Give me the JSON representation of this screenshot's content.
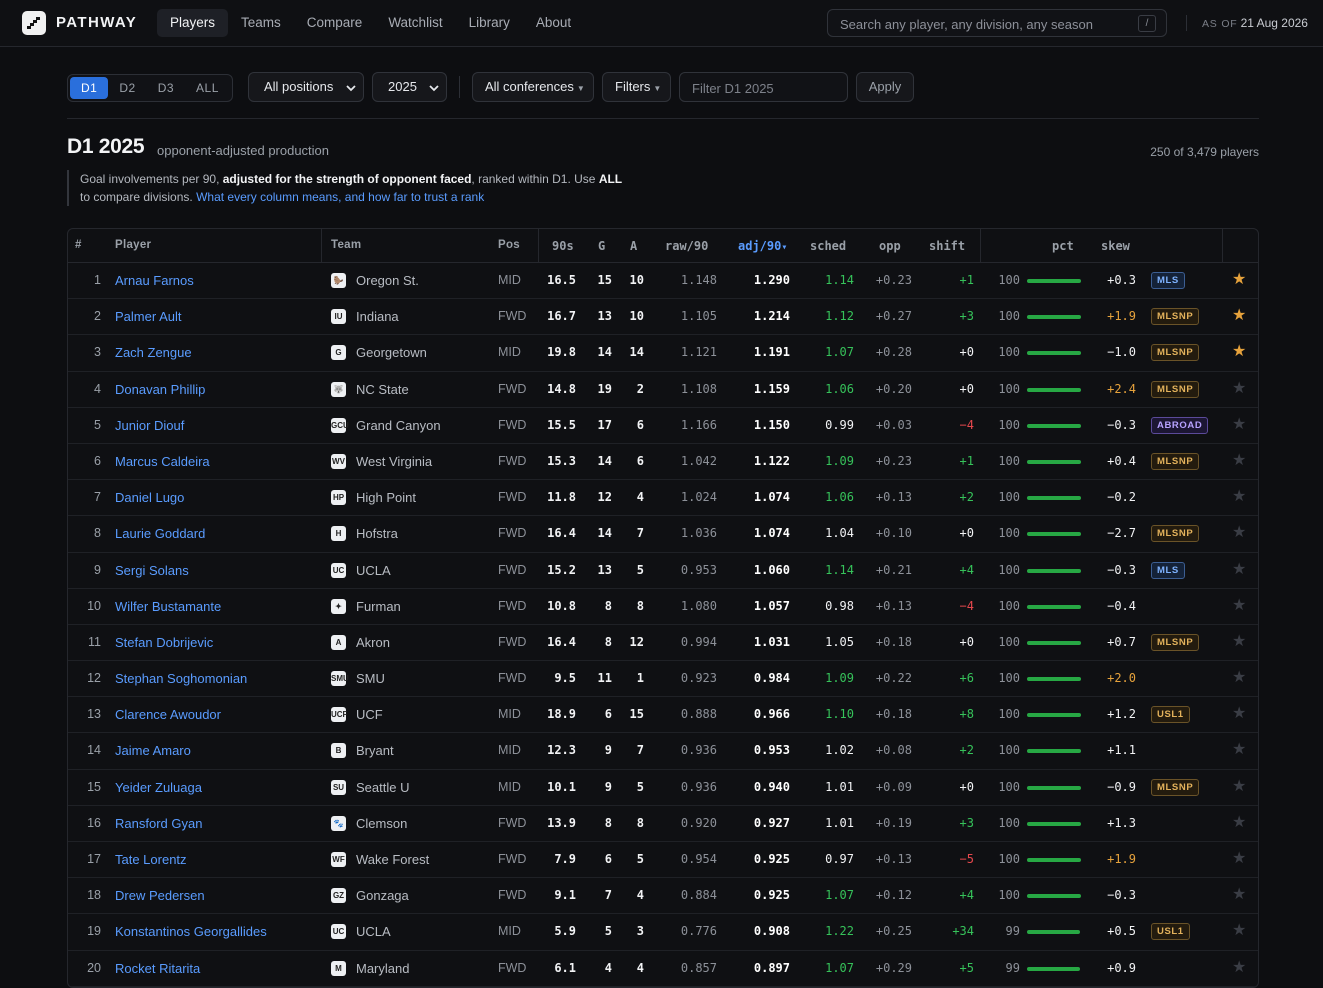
{
  "brand": "PATHWAY",
  "nav": [
    "Players",
    "Teams",
    "Compare",
    "Watchlist",
    "Library",
    "About"
  ],
  "nav_active": 0,
  "search": {
    "placeholder": "Search any player, any division, any season",
    "shortcut": "/"
  },
  "as_of": {
    "label": "AS OF",
    "date": "21 Aug 2026"
  },
  "divisions": [
    "D1",
    "D2",
    "D3",
    "ALL"
  ],
  "division_active": 0,
  "filters": {
    "position": "All positions",
    "season": "2025",
    "conference": "All conferences",
    "filters_label": "Filters",
    "filter_placeholder": "Filter D1 2025",
    "apply_label": "Apply"
  },
  "heading": {
    "title": "D1 2025",
    "subtitle": "opponent-adjusted production",
    "count": "250 of 3,479 players"
  },
  "description": {
    "pre": "Goal involvements per 90, ",
    "bold1": "adjusted for the strength of opponent faced",
    "mid": ", ranked within D1. Use ",
    "bold2": "ALL",
    "post": "to compare divisions. ",
    "link": "What every column means, and how far to trust a rank"
  },
  "columns": {
    "rank": "#",
    "player": "Player",
    "team": "Team",
    "pos": "Pos",
    "nineties": "90s",
    "g": "G",
    "a": "A",
    "raw": "raw/90",
    "adj": "adj/90",
    "sort_indicator": "▾",
    "sched": "sched",
    "opp": "opp",
    "shift": "shift",
    "pct": "pct",
    "skew": "skew"
  },
  "colors": {
    "accent": "#5a9cff",
    "green": "#36c25a",
    "red": "#e5484d",
    "amber": "#e6a23c",
    "star_on": "#e6a23c",
    "star_off": "#3a3d45"
  },
  "rows": [
    {
      "rank": "1",
      "player": "Arnau Farnos",
      "team": "Oregon St.",
      "logo": "🦫",
      "pos": "MID",
      "n90": "16.5",
      "g": "15",
      "a": "10",
      "raw": "1.148",
      "adj": "1.290",
      "sched": "1.14",
      "sched_c": "green",
      "opp": "+0.23",
      "shift": "+1",
      "shift_c": "green",
      "pct": "100",
      "pct_v": 1.0,
      "skew": "+0.3",
      "skew_c": "white",
      "badge": "MLS",
      "badge_c": "mls",
      "star": true
    },
    {
      "rank": "2",
      "player": "Palmer Ault",
      "team": "Indiana",
      "logo": "IU",
      "pos": "FWD",
      "n90": "16.7",
      "g": "13",
      "a": "10",
      "raw": "1.105",
      "adj": "1.214",
      "sched": "1.12",
      "sched_c": "green",
      "opp": "+0.27",
      "shift": "+3",
      "shift_c": "green",
      "pct": "100",
      "pct_v": 1.0,
      "skew": "+1.9",
      "skew_c": "amber",
      "badge": "MLSNP",
      "badge_c": "mlsnp",
      "star": true
    },
    {
      "rank": "3",
      "player": "Zach Zengue",
      "team": "Georgetown",
      "logo": "G",
      "pos": "MID",
      "n90": "19.8",
      "g": "14",
      "a": "14",
      "raw": "1.121",
      "adj": "1.191",
      "sched": "1.07",
      "sched_c": "green",
      "opp": "+0.28",
      "shift": "+0",
      "shift_c": "white",
      "pct": "100",
      "pct_v": 1.0,
      "skew": "−1.0",
      "skew_c": "white",
      "badge": "MLSNP",
      "badge_c": "mlsnp",
      "star": true
    },
    {
      "rank": "4",
      "player": "Donavan Phillip",
      "team": "NC State",
      "logo": "🐺",
      "pos": "FWD",
      "n90": "14.8",
      "g": "19",
      "a": "2",
      "raw": "1.108",
      "adj": "1.159",
      "sched": "1.06",
      "sched_c": "green",
      "opp": "+0.20",
      "shift": "+0",
      "shift_c": "white",
      "pct": "100",
      "pct_v": 1.0,
      "skew": "+2.4",
      "skew_c": "amber",
      "badge": "MLSNP",
      "badge_c": "mlsnp",
      "star": false
    },
    {
      "rank": "5",
      "player": "Junior Diouf",
      "team": "Grand Canyon",
      "logo": "GCU",
      "pos": "FWD",
      "n90": "15.5",
      "g": "17",
      "a": "6",
      "raw": "1.166",
      "adj": "1.150",
      "sched": "0.99",
      "sched_c": "white",
      "opp": "+0.03",
      "shift": "−4",
      "shift_c": "red",
      "pct": "100",
      "pct_v": 1.0,
      "skew": "−0.3",
      "skew_c": "white",
      "badge": "ABROAD",
      "badge_c": "abroad",
      "star": false
    },
    {
      "rank": "6",
      "player": "Marcus Caldeira",
      "team": "West Virginia",
      "logo": "WV",
      "pos": "FWD",
      "n90": "15.3",
      "g": "14",
      "a": "6",
      "raw": "1.042",
      "adj": "1.122",
      "sched": "1.09",
      "sched_c": "green",
      "opp": "+0.23",
      "shift": "+1",
      "shift_c": "green",
      "pct": "100",
      "pct_v": 1.0,
      "skew": "+0.4",
      "skew_c": "white",
      "badge": "MLSNP",
      "badge_c": "mlsnp",
      "star": false
    },
    {
      "rank": "7",
      "player": "Daniel Lugo",
      "team": "High Point",
      "logo": "HP",
      "pos": "FWD",
      "n90": "11.8",
      "g": "12",
      "a": "4",
      "raw": "1.024",
      "adj": "1.074",
      "sched": "1.06",
      "sched_c": "green",
      "opp": "+0.13",
      "shift": "+2",
      "shift_c": "green",
      "pct": "100",
      "pct_v": 1.0,
      "skew": "−0.2",
      "skew_c": "white",
      "badge": "",
      "badge_c": "",
      "star": false
    },
    {
      "rank": "8",
      "player": "Laurie Goddard",
      "team": "Hofstra",
      "logo": "H",
      "pos": "FWD",
      "n90": "16.4",
      "g": "14",
      "a": "7",
      "raw": "1.036",
      "adj": "1.074",
      "sched": "1.04",
      "sched_c": "white",
      "opp": "+0.10",
      "shift": "+0",
      "shift_c": "white",
      "pct": "100",
      "pct_v": 1.0,
      "skew": "−2.7",
      "skew_c": "white",
      "badge": "MLSNP",
      "badge_c": "mlsnp",
      "star": false
    },
    {
      "rank": "9",
      "player": "Sergi Solans",
      "team": "UCLA",
      "logo": "UC",
      "pos": "FWD",
      "n90": "15.2",
      "g": "13",
      "a": "5",
      "raw": "0.953",
      "adj": "1.060",
      "sched": "1.14",
      "sched_c": "green",
      "opp": "+0.21",
      "shift": "+4",
      "shift_c": "green",
      "pct": "100",
      "pct_v": 1.0,
      "skew": "−0.3",
      "skew_c": "white",
      "badge": "MLS",
      "badge_c": "mls",
      "star": false
    },
    {
      "rank": "10",
      "player": "Wilfer Bustamante",
      "team": "Furman",
      "logo": "✦",
      "pos": "FWD",
      "n90": "10.8",
      "g": "8",
      "a": "8",
      "raw": "1.080",
      "adj": "1.057",
      "sched": "0.98",
      "sched_c": "white",
      "opp": "+0.13",
      "shift": "−4",
      "shift_c": "red",
      "pct": "100",
      "pct_v": 1.0,
      "skew": "−0.4",
      "skew_c": "white",
      "badge": "",
      "badge_c": "",
      "star": false
    },
    {
      "rank": "11",
      "player": "Stefan Dobrijevic",
      "team": "Akron",
      "logo": "A",
      "pos": "FWD",
      "n90": "16.4",
      "g": "8",
      "a": "12",
      "raw": "0.994",
      "adj": "1.031",
      "sched": "1.05",
      "sched_c": "white",
      "opp": "+0.18",
      "shift": "+0",
      "shift_c": "white",
      "pct": "100",
      "pct_v": 1.0,
      "skew": "+0.7",
      "skew_c": "white",
      "badge": "MLSNP",
      "badge_c": "mlsnp",
      "star": false
    },
    {
      "rank": "12",
      "player": "Stephan Soghomonian",
      "team": "SMU",
      "logo": "SMU",
      "pos": "FWD",
      "n90": "9.5",
      "g": "11",
      "a": "1",
      "raw": "0.923",
      "adj": "0.984",
      "sched": "1.09",
      "sched_c": "green",
      "opp": "+0.22",
      "shift": "+6",
      "shift_c": "green",
      "pct": "100",
      "pct_v": 1.0,
      "skew": "+2.0",
      "skew_c": "amber",
      "badge": "",
      "badge_c": "",
      "star": false
    },
    {
      "rank": "13",
      "player": "Clarence Awoudor",
      "team": "UCF",
      "logo": "UCF",
      "pos": "MID",
      "n90": "18.9",
      "g": "6",
      "a": "15",
      "raw": "0.888",
      "adj": "0.966",
      "sched": "1.10",
      "sched_c": "green",
      "opp": "+0.18",
      "shift": "+8",
      "shift_c": "green",
      "pct": "100",
      "pct_v": 1.0,
      "skew": "+1.2",
      "skew_c": "white",
      "badge": "USL1",
      "badge_c": "usl1",
      "star": false
    },
    {
      "rank": "14",
      "player": "Jaime Amaro",
      "team": "Bryant",
      "logo": "B",
      "pos": "MID",
      "n90": "12.3",
      "g": "9",
      "a": "7",
      "raw": "0.936",
      "adj": "0.953",
      "sched": "1.02",
      "sched_c": "white",
      "opp": "+0.08",
      "shift": "+2",
      "shift_c": "green",
      "pct": "100",
      "pct_v": 1.0,
      "skew": "+1.1",
      "skew_c": "white",
      "badge": "",
      "badge_c": "",
      "star": false
    },
    {
      "rank": "15",
      "player": "Yeider Zuluaga",
      "team": "Seattle U",
      "logo": "SU",
      "pos": "MID",
      "n90": "10.1",
      "g": "9",
      "a": "5",
      "raw": "0.936",
      "adj": "0.940",
      "sched": "1.01",
      "sched_c": "white",
      "opp": "+0.09",
      "shift": "+0",
      "shift_c": "white",
      "pct": "100",
      "pct_v": 1.0,
      "skew": "−0.9",
      "skew_c": "white",
      "badge": "MLSNP",
      "badge_c": "mlsnp",
      "star": false
    },
    {
      "rank": "16",
      "player": "Ransford Gyan",
      "team": "Clemson",
      "logo": "🐾",
      "pos": "FWD",
      "n90": "13.9",
      "g": "8",
      "a": "8",
      "raw": "0.920",
      "adj": "0.927",
      "sched": "1.01",
      "sched_c": "white",
      "opp": "+0.19",
      "shift": "+3",
      "shift_c": "green",
      "pct": "100",
      "pct_v": 1.0,
      "skew": "+1.3",
      "skew_c": "white",
      "badge": "",
      "badge_c": "",
      "star": false
    },
    {
      "rank": "17",
      "player": "Tate Lorentz",
      "team": "Wake Forest",
      "logo": "WF",
      "pos": "FWD",
      "n90": "7.9",
      "g": "6",
      "a": "5",
      "raw": "0.954",
      "adj": "0.925",
      "sched": "0.97",
      "sched_c": "white",
      "opp": "+0.13",
      "shift": "−5",
      "shift_c": "red",
      "pct": "100",
      "pct_v": 1.0,
      "skew": "+1.9",
      "skew_c": "amber",
      "badge": "",
      "badge_c": "",
      "star": false
    },
    {
      "rank": "18",
      "player": "Drew Pedersen",
      "team": "Gonzaga",
      "logo": "GZ",
      "pos": "FWD",
      "n90": "9.1",
      "g": "7",
      "a": "4",
      "raw": "0.884",
      "adj": "0.925",
      "sched": "1.07",
      "sched_c": "green",
      "opp": "+0.12",
      "shift": "+4",
      "shift_c": "green",
      "pct": "100",
      "pct_v": 1.0,
      "skew": "−0.3",
      "skew_c": "white",
      "badge": "",
      "badge_c": "",
      "star": false
    },
    {
      "rank": "19",
      "player": "Konstantinos Georgallides",
      "team": "UCLA",
      "logo": "UC",
      "pos": "MID",
      "n90": "5.9",
      "g": "5",
      "a": "3",
      "raw": "0.776",
      "adj": "0.908",
      "sched": "1.22",
      "sched_c": "green",
      "opp": "+0.25",
      "shift": "+34",
      "shift_c": "green",
      "pct": "99",
      "pct_v": 0.99,
      "skew": "+0.5",
      "skew_c": "white",
      "badge": "USL1",
      "badge_c": "usl1",
      "star": false
    },
    {
      "rank": "20",
      "player": "Rocket Ritarita",
      "team": "Maryland",
      "logo": "M",
      "pos": "FWD",
      "n90": "6.1",
      "g": "4",
      "a": "4",
      "raw": "0.857",
      "adj": "0.897",
      "sched": "1.07",
      "sched_c": "green",
      "opp": "+0.29",
      "shift": "+5",
      "shift_c": "green",
      "pct": "99",
      "pct_v": 0.99,
      "skew": "+0.9",
      "skew_c": "white",
      "badge": "",
      "badge_c": "",
      "star": false
    }
  ]
}
